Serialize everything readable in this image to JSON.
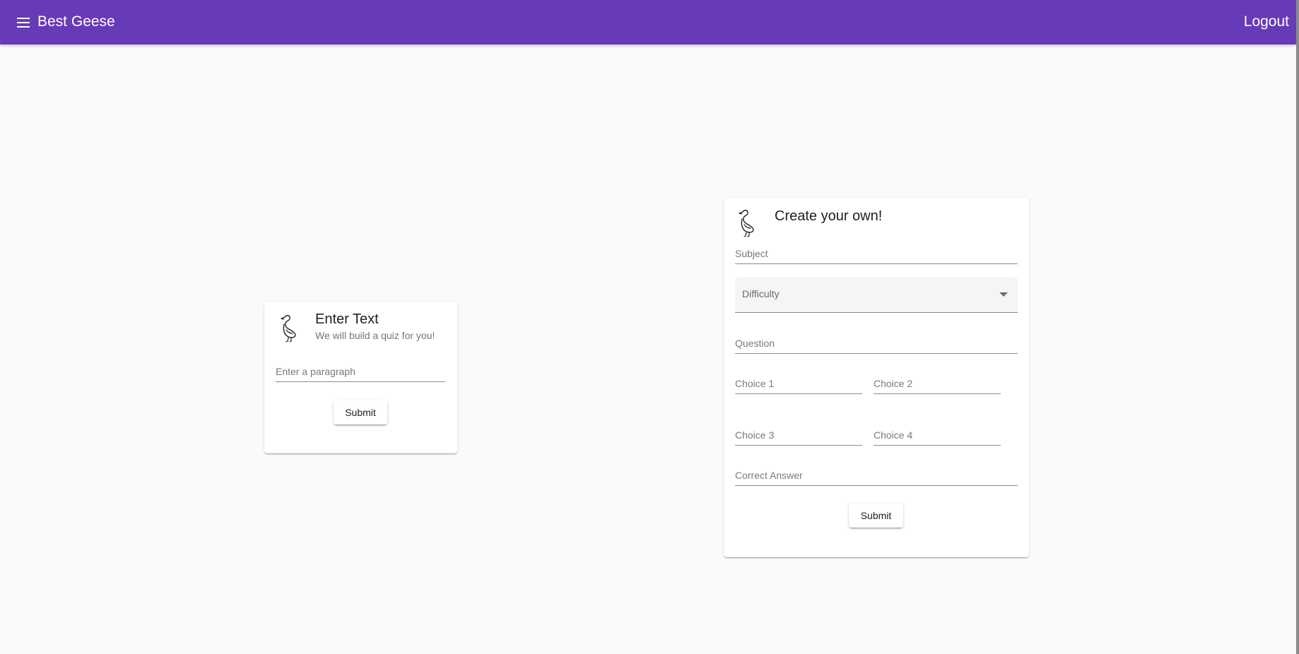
{
  "toolbar": {
    "title": "Best Geese",
    "logout_label": "Logout",
    "background": "#673ab7",
    "menu_icon": "menu-icon"
  },
  "text_card": {
    "icon": "goose-icon",
    "title": "Enter Text",
    "subtitle": "We will build a quiz for you!",
    "paragraph_placeholder": "Enter a paragraph",
    "submit_label": "Submit"
  },
  "create_card": {
    "icon": "goose-icon",
    "title": "Create your own!",
    "subject_placeholder": "Subject",
    "difficulty_label": "Difficulty",
    "question_placeholder": "Question",
    "choice1_placeholder": "Choice 1",
    "choice2_placeholder": "Choice 2",
    "choice3_placeholder": "Choice 3",
    "choice4_placeholder": "Choice 4",
    "correct_answer_placeholder": "Correct Answer",
    "submit_label": "Submit"
  }
}
